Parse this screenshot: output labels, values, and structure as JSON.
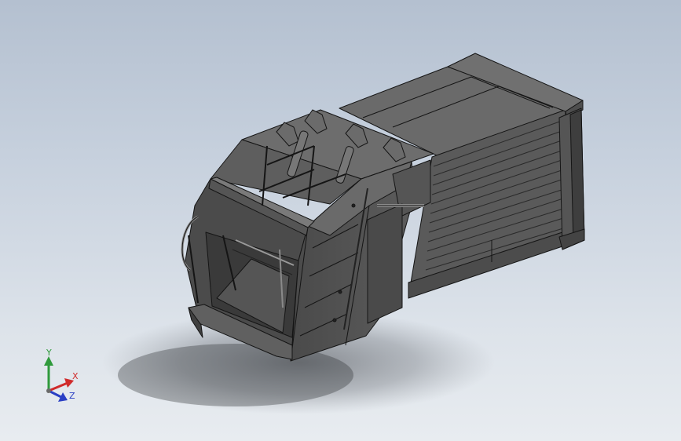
{
  "viewport": {
    "background_top": "#b4c0d0",
    "background_bottom": "#e8ecf0"
  },
  "model": {
    "kind": "3D CAD model",
    "render_style": "shaded with edges",
    "base_color": "#5a5a5a",
    "edge_color": "#151515"
  },
  "triad": {
    "y_label": "Y",
    "x_label": "X",
    "z_label": "Z",
    "y_color": "#2f9a3c",
    "x_color": "#d02b2b",
    "z_color": "#2a3fc4"
  }
}
